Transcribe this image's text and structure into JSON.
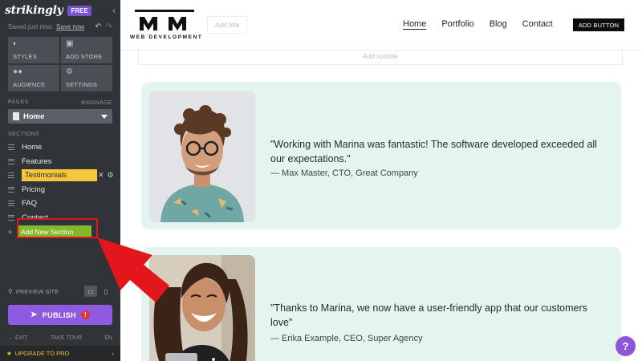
{
  "sidebar": {
    "brand": "strikingly",
    "badge": "FREE",
    "saved_status": "Saved just now.",
    "save_now": "Save now",
    "tiles": [
      {
        "label": "STYLES",
        "icon": "palette-icon"
      },
      {
        "label": "ADD STORE",
        "icon": "store-icon"
      },
      {
        "label": "AUDIENCE",
        "icon": "users-icon"
      },
      {
        "label": "SETTINGS",
        "icon": "gear-icon"
      }
    ],
    "pages_label": "PAGES",
    "manage_label": "MANAGE",
    "current_page": "Home",
    "sections_label": "SECTIONS",
    "sections": [
      {
        "label": "Home"
      },
      {
        "label": "Features"
      },
      {
        "label": "Testimonials"
      },
      {
        "label": "Pricing"
      },
      {
        "label": "FAQ"
      },
      {
        "label": "Contact"
      }
    ],
    "add_section": "Add New Section",
    "preview_site": "PREVIEW SITE",
    "publish": "PUBLISH",
    "exit": "EXIT",
    "take_tour": "TAKE TOUR",
    "language": "EN",
    "upgrade": "UPGRADE TO PRO"
  },
  "header": {
    "logo_text": "WEB DEVELOPMENT",
    "add_title": "Add title",
    "nav": [
      {
        "label": "Home"
      },
      {
        "label": "Portfolio"
      },
      {
        "label": "Blog"
      },
      {
        "label": "Contact"
      }
    ],
    "add_button": "ADD BUTTON",
    "add_subtitle": "Add subtitle"
  },
  "testimonials": [
    {
      "quote": "\"Working with Marina was fantastic! The software developed exceeded all our expectations.\"",
      "author": "— Max Master, CTO, Great Company"
    },
    {
      "quote": "\"Thanks to Marina, we now have a user-friendly app that our customers love\"",
      "author": "— Erika Example, CEO, Super Agency"
    }
  ],
  "help": "?",
  "colors": {
    "sidebar_bg": "#303338",
    "highlight_yellow": "#f5c73b",
    "add_section_green": "#84b82c",
    "publish_purple": "#8e5ae0",
    "card_mint": "#e3f5ee",
    "annotation_red": "#e3171b"
  }
}
